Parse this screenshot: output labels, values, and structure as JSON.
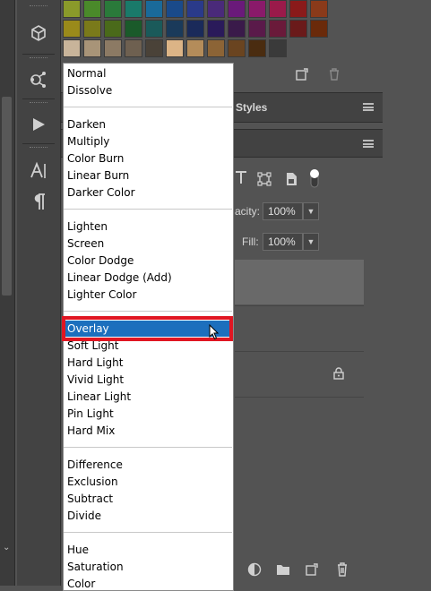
{
  "panels": {
    "styles_tab": "Styles",
    "opacity": {
      "label": "Opacity:",
      "label_visible": "acity:",
      "value": "100%"
    },
    "fill": {
      "label": "Fill:",
      "value": "100%"
    }
  },
  "blend_menu": {
    "selected": "Overlay",
    "groups": [
      [
        "Normal",
        "Dissolve"
      ],
      [
        "Darken",
        "Multiply",
        "Color Burn",
        "Linear Burn",
        "Darker Color"
      ],
      [
        "Lighten",
        "Screen",
        "Color Dodge",
        "Linear Dodge (Add)",
        "Lighter Color"
      ],
      [
        "Overlay",
        "Soft Light",
        "Hard Light",
        "Vivid Light",
        "Linear Light",
        "Pin Light",
        "Hard Mix"
      ],
      [
        "Difference",
        "Exclusion",
        "Subtract",
        "Divide"
      ],
      [
        "Hue",
        "Saturation",
        "Color"
      ]
    ]
  },
  "swatches": {
    "row1": [
      "#8a9a2a",
      "#4a8a2a",
      "#2a7a3a",
      "#1a7a6a",
      "#1a6a9a",
      "#1a4a8a",
      "#2a3a8a",
      "#4a2a7a",
      "#6a1a7a",
      "#8a1a6a",
      "#9a1a4a",
      "#8a1a1a",
      "#8a3a1a"
    ],
    "row2": [
      "#9a8a1a",
      "#7a7a1a",
      "#4a6a1a",
      "#1a5a2a",
      "#1a5a5a",
      "#1a3a5a",
      "#1a2a5a",
      "#2a1a5a",
      "#3a1a4a",
      "#5a1a4a",
      "#6a1a3a",
      "#6a1a1a",
      "#6a2a0a"
    ],
    "row3": [
      "#c8b49a",
      "#a89478",
      "#8c7a64",
      "#6e6050",
      "#4a4238",
      "#dcb486",
      "#b48c5a",
      "#8c6436",
      "#6a4420",
      "#4a2c10",
      "#3a3a3a"
    ]
  },
  "icons": {
    "tools": [
      "cube-3d-icon",
      "molecule-icon",
      "play-icon",
      "character-icon",
      "paragraph-icon"
    ],
    "swatch_footer": [
      "new-swatch-icon",
      "trash-icon"
    ],
    "layer_filters": [
      "type-filter-icon",
      "shape-filter-icon",
      "smart-object-filter-icon",
      "toggle-icon"
    ],
    "bottom": [
      "adjustment-layer-icon",
      "folder-icon",
      "new-layer-icon",
      "trash-icon"
    ]
  },
  "colors": {
    "menu_selection": "#1c6fbd",
    "highlight_box": "#e01622",
    "panel_bg": "#535353"
  }
}
